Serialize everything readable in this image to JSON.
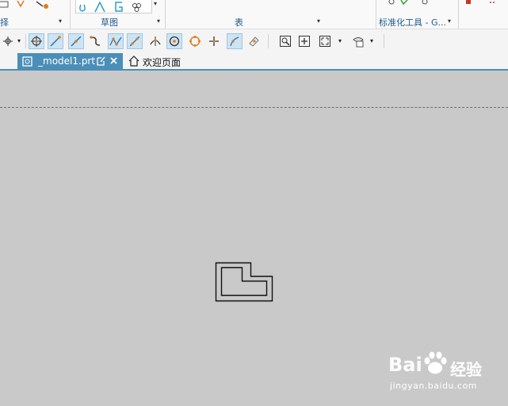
{
  "ribbon": {
    "group_left_label": "择",
    "sketch_label": "草图",
    "table_label": "表",
    "std_tools_label": "标准化工具 - G..."
  },
  "tabs": {
    "active_file": "_model1.prt",
    "home": "欢迎页面"
  },
  "icons": {
    "tab_file": "part-file-icon",
    "tab_modified": "modified-edit-icon",
    "tab_close": "close-icon",
    "tab_home": "home-icon"
  },
  "watermark": {
    "brand_text": "Bai",
    "brand_suffix": "经验",
    "url": "jingyan.baidu.com"
  },
  "colors": {
    "accent": "#4b8fb8",
    "canvas": "#c9c9c9",
    "active_toggle": "#cde4f3",
    "icon_orange": "#e07b1a",
    "icon_blue": "#2a6fb0"
  }
}
